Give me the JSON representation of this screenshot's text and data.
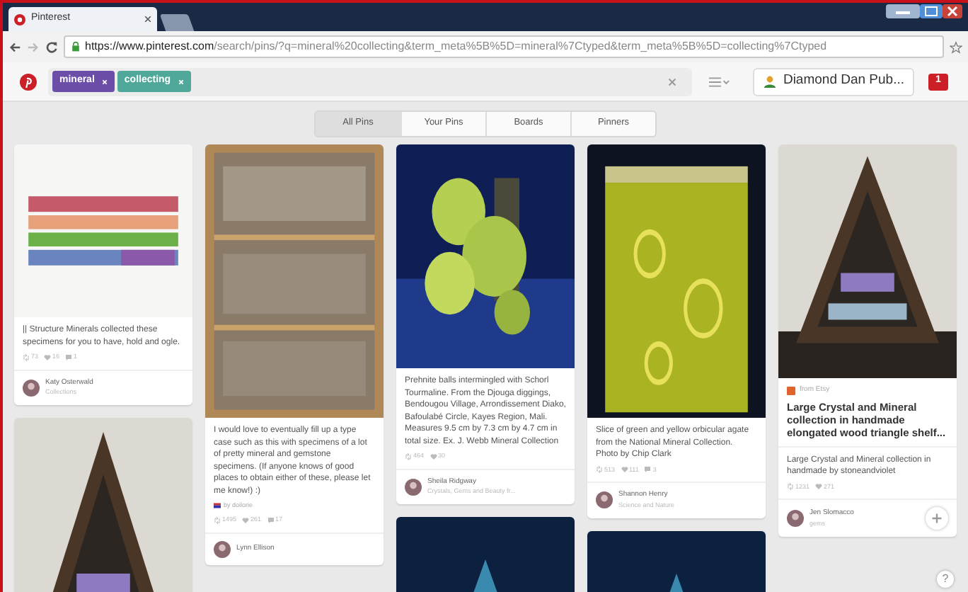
{
  "browser": {
    "tab_title": "Pinterest",
    "url_host": "https://www.pinterest.com",
    "url_path": "/search/pins/?q=mineral%20collecting&term_meta%5B%5D=mineral%7Ctyped&term_meta%5B%5D=collecting%7Ctyped"
  },
  "header": {
    "search_tags": [
      {
        "label": "mineral",
        "color": "#6c4ea8"
      },
      {
        "label": "collecting",
        "color": "#4fa89a"
      }
    ],
    "user_name": "Diamond Dan Pub...",
    "notification_count": "1"
  },
  "filter_tabs": [
    {
      "label": "All Pins",
      "selected": true
    },
    {
      "label": "Your Pins",
      "selected": false
    },
    {
      "label": "Boards",
      "selected": false
    },
    {
      "label": "Pinners",
      "selected": false
    }
  ],
  "columns": [
    [
      {
        "description": "|| Structure Minerals collected these specimens for you to have, hold and ogle.",
        "stats": [
          "73",
          "16",
          "1"
        ],
        "author": "Katy Osterwald",
        "board": "Collections"
      },
      {
        "kind": "picture"
      }
    ],
    [
      {
        "description": "I would love to eventually fill up a type case such as this with specimens of a lot of pretty mineral and gemstone specimens. (If anyone knows of good places to obtain either of these, please let me know!) :)",
        "via": "by doilorie",
        "stats": [
          "1495",
          "261",
          "17"
        ],
        "author": "Lynn Ellison"
      }
    ],
    [
      {
        "description": "Prehnite balls intermingled with Schorl Tourmaline. From the Djouga diggings, Bendougou Village, Arrondissement Diako, Bafoulabé Circle, Kayes Region, Mali. Measures 9.5 cm by 7.3 cm by 4.7 cm in total size. Ex. J. Webb Mineral Collection",
        "stats": [
          "464",
          "30"
        ],
        "author": "Sheila Ridgway",
        "board": "Crystals, Gems and Beauty fr..."
      },
      {
        "kind": "picture"
      }
    ],
    [
      {
        "description": "Slice of green and yellow orbicular agate from the National Mineral Collection. Photo by Chip Clark",
        "stats": [
          "513",
          "111",
          "3"
        ],
        "author": "Shannon Henry",
        "board": "Science and Nature"
      },
      {
        "kind": "picture"
      }
    ],
    [
      {
        "source": "from Etsy",
        "title": "Large Crystal and Mineral collection in handmade elongated wood triangle shelf...",
        "description": "Large Crystal and Mineral collection in handmade by stoneandviolet",
        "stats": [
          "1231",
          "271"
        ],
        "author": "Jen Slomacco",
        "board": "gems"
      }
    ]
  ],
  "help_label": "?"
}
